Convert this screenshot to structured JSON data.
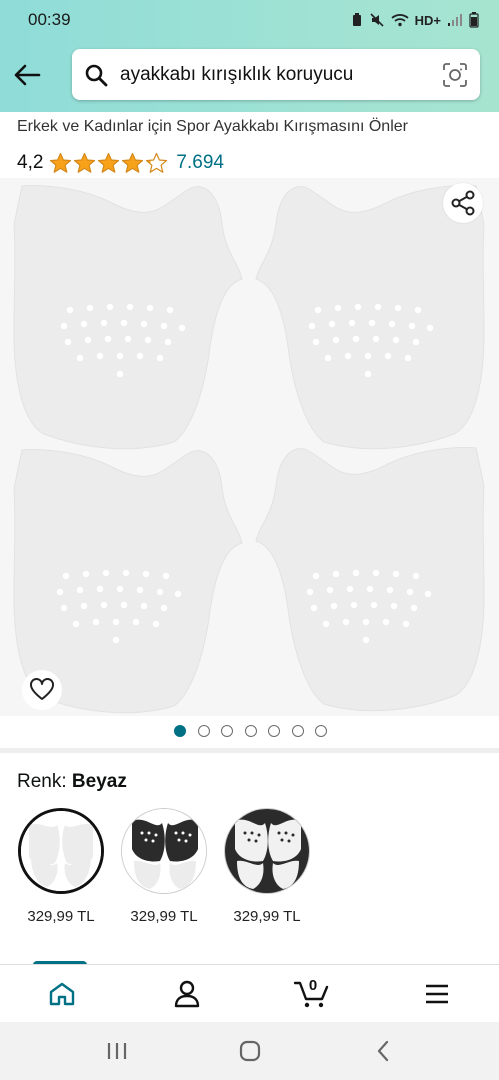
{
  "status": {
    "time": "00:39",
    "network": "HD+"
  },
  "search": {
    "query": "ayakkabı kırışıklık koruyucu"
  },
  "product": {
    "title_line": "Erkek ve Kadınlar için Spor Ayakkabı Kırışmasını Önler",
    "rating_value": "4,2",
    "rating_stars": 4.2,
    "rating_count": "7.694",
    "gallery_pages": 7,
    "gallery_active_page": 1
  },
  "color": {
    "label": "Renk:",
    "selected": "Beyaz",
    "options": [
      {
        "price": "329,99 TL",
        "variant": "white"
      },
      {
        "price": "329,99 TL",
        "variant": "white-black"
      },
      {
        "price": "329,99 TL",
        "variant": "black-white"
      }
    ]
  },
  "nav": {
    "cart_count": "0",
    "items": [
      "home-icon",
      "account-icon",
      "cart-icon",
      "menu-icon"
    ]
  },
  "colors": {
    "accent": "#007185",
    "star": "#f7a21a",
    "header": "#9fe2d4"
  }
}
